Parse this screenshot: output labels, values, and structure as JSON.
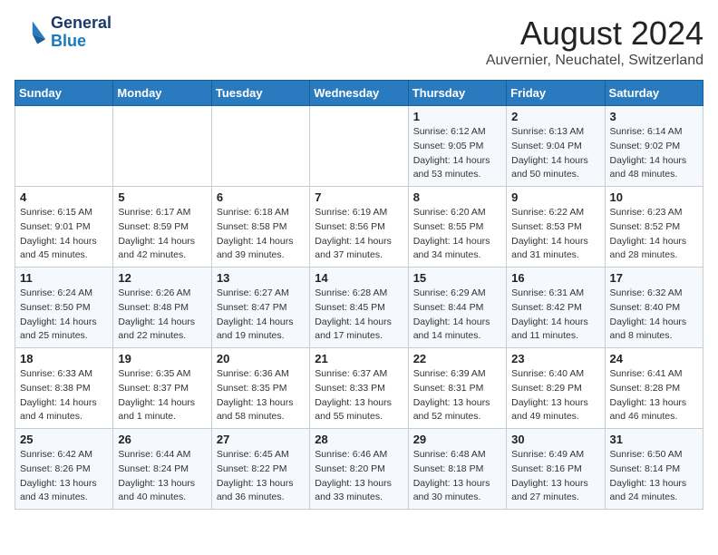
{
  "header": {
    "logo_line1": "General",
    "logo_line2": "Blue",
    "main_title": "August 2024",
    "subtitle": "Auvernier, Neuchatel, Switzerland"
  },
  "days_of_week": [
    "Sunday",
    "Monday",
    "Tuesday",
    "Wednesday",
    "Thursday",
    "Friday",
    "Saturday"
  ],
  "weeks": [
    [
      {
        "day": "",
        "info": ""
      },
      {
        "day": "",
        "info": ""
      },
      {
        "day": "",
        "info": ""
      },
      {
        "day": "",
        "info": ""
      },
      {
        "day": "1",
        "info": "Sunrise: 6:12 AM\nSunset: 9:05 PM\nDaylight: 14 hours\nand 53 minutes."
      },
      {
        "day": "2",
        "info": "Sunrise: 6:13 AM\nSunset: 9:04 PM\nDaylight: 14 hours\nand 50 minutes."
      },
      {
        "day": "3",
        "info": "Sunrise: 6:14 AM\nSunset: 9:02 PM\nDaylight: 14 hours\nand 48 minutes."
      }
    ],
    [
      {
        "day": "4",
        "info": "Sunrise: 6:15 AM\nSunset: 9:01 PM\nDaylight: 14 hours\nand 45 minutes."
      },
      {
        "day": "5",
        "info": "Sunrise: 6:17 AM\nSunset: 8:59 PM\nDaylight: 14 hours\nand 42 minutes."
      },
      {
        "day": "6",
        "info": "Sunrise: 6:18 AM\nSunset: 8:58 PM\nDaylight: 14 hours\nand 39 minutes."
      },
      {
        "day": "7",
        "info": "Sunrise: 6:19 AM\nSunset: 8:56 PM\nDaylight: 14 hours\nand 37 minutes."
      },
      {
        "day": "8",
        "info": "Sunrise: 6:20 AM\nSunset: 8:55 PM\nDaylight: 14 hours\nand 34 minutes."
      },
      {
        "day": "9",
        "info": "Sunrise: 6:22 AM\nSunset: 8:53 PM\nDaylight: 14 hours\nand 31 minutes."
      },
      {
        "day": "10",
        "info": "Sunrise: 6:23 AM\nSunset: 8:52 PM\nDaylight: 14 hours\nand 28 minutes."
      }
    ],
    [
      {
        "day": "11",
        "info": "Sunrise: 6:24 AM\nSunset: 8:50 PM\nDaylight: 14 hours\nand 25 minutes."
      },
      {
        "day": "12",
        "info": "Sunrise: 6:26 AM\nSunset: 8:48 PM\nDaylight: 14 hours\nand 22 minutes."
      },
      {
        "day": "13",
        "info": "Sunrise: 6:27 AM\nSunset: 8:47 PM\nDaylight: 14 hours\nand 19 minutes."
      },
      {
        "day": "14",
        "info": "Sunrise: 6:28 AM\nSunset: 8:45 PM\nDaylight: 14 hours\nand 17 minutes."
      },
      {
        "day": "15",
        "info": "Sunrise: 6:29 AM\nSunset: 8:44 PM\nDaylight: 14 hours\nand 14 minutes."
      },
      {
        "day": "16",
        "info": "Sunrise: 6:31 AM\nSunset: 8:42 PM\nDaylight: 14 hours\nand 11 minutes."
      },
      {
        "day": "17",
        "info": "Sunrise: 6:32 AM\nSunset: 8:40 PM\nDaylight: 14 hours\nand 8 minutes."
      }
    ],
    [
      {
        "day": "18",
        "info": "Sunrise: 6:33 AM\nSunset: 8:38 PM\nDaylight: 14 hours\nand 4 minutes."
      },
      {
        "day": "19",
        "info": "Sunrise: 6:35 AM\nSunset: 8:37 PM\nDaylight: 14 hours\nand 1 minute."
      },
      {
        "day": "20",
        "info": "Sunrise: 6:36 AM\nSunset: 8:35 PM\nDaylight: 13 hours\nand 58 minutes."
      },
      {
        "day": "21",
        "info": "Sunrise: 6:37 AM\nSunset: 8:33 PM\nDaylight: 13 hours\nand 55 minutes."
      },
      {
        "day": "22",
        "info": "Sunrise: 6:39 AM\nSunset: 8:31 PM\nDaylight: 13 hours\nand 52 minutes."
      },
      {
        "day": "23",
        "info": "Sunrise: 6:40 AM\nSunset: 8:29 PM\nDaylight: 13 hours\nand 49 minutes."
      },
      {
        "day": "24",
        "info": "Sunrise: 6:41 AM\nSunset: 8:28 PM\nDaylight: 13 hours\nand 46 minutes."
      }
    ],
    [
      {
        "day": "25",
        "info": "Sunrise: 6:42 AM\nSunset: 8:26 PM\nDaylight: 13 hours\nand 43 minutes."
      },
      {
        "day": "26",
        "info": "Sunrise: 6:44 AM\nSunset: 8:24 PM\nDaylight: 13 hours\nand 40 minutes."
      },
      {
        "day": "27",
        "info": "Sunrise: 6:45 AM\nSunset: 8:22 PM\nDaylight: 13 hours\nand 36 minutes."
      },
      {
        "day": "28",
        "info": "Sunrise: 6:46 AM\nSunset: 8:20 PM\nDaylight: 13 hours\nand 33 minutes."
      },
      {
        "day": "29",
        "info": "Sunrise: 6:48 AM\nSunset: 8:18 PM\nDaylight: 13 hours\nand 30 minutes."
      },
      {
        "day": "30",
        "info": "Sunrise: 6:49 AM\nSunset: 8:16 PM\nDaylight: 13 hours\nand 27 minutes."
      },
      {
        "day": "31",
        "info": "Sunrise: 6:50 AM\nSunset: 8:14 PM\nDaylight: 13 hours\nand 24 minutes."
      }
    ]
  ]
}
